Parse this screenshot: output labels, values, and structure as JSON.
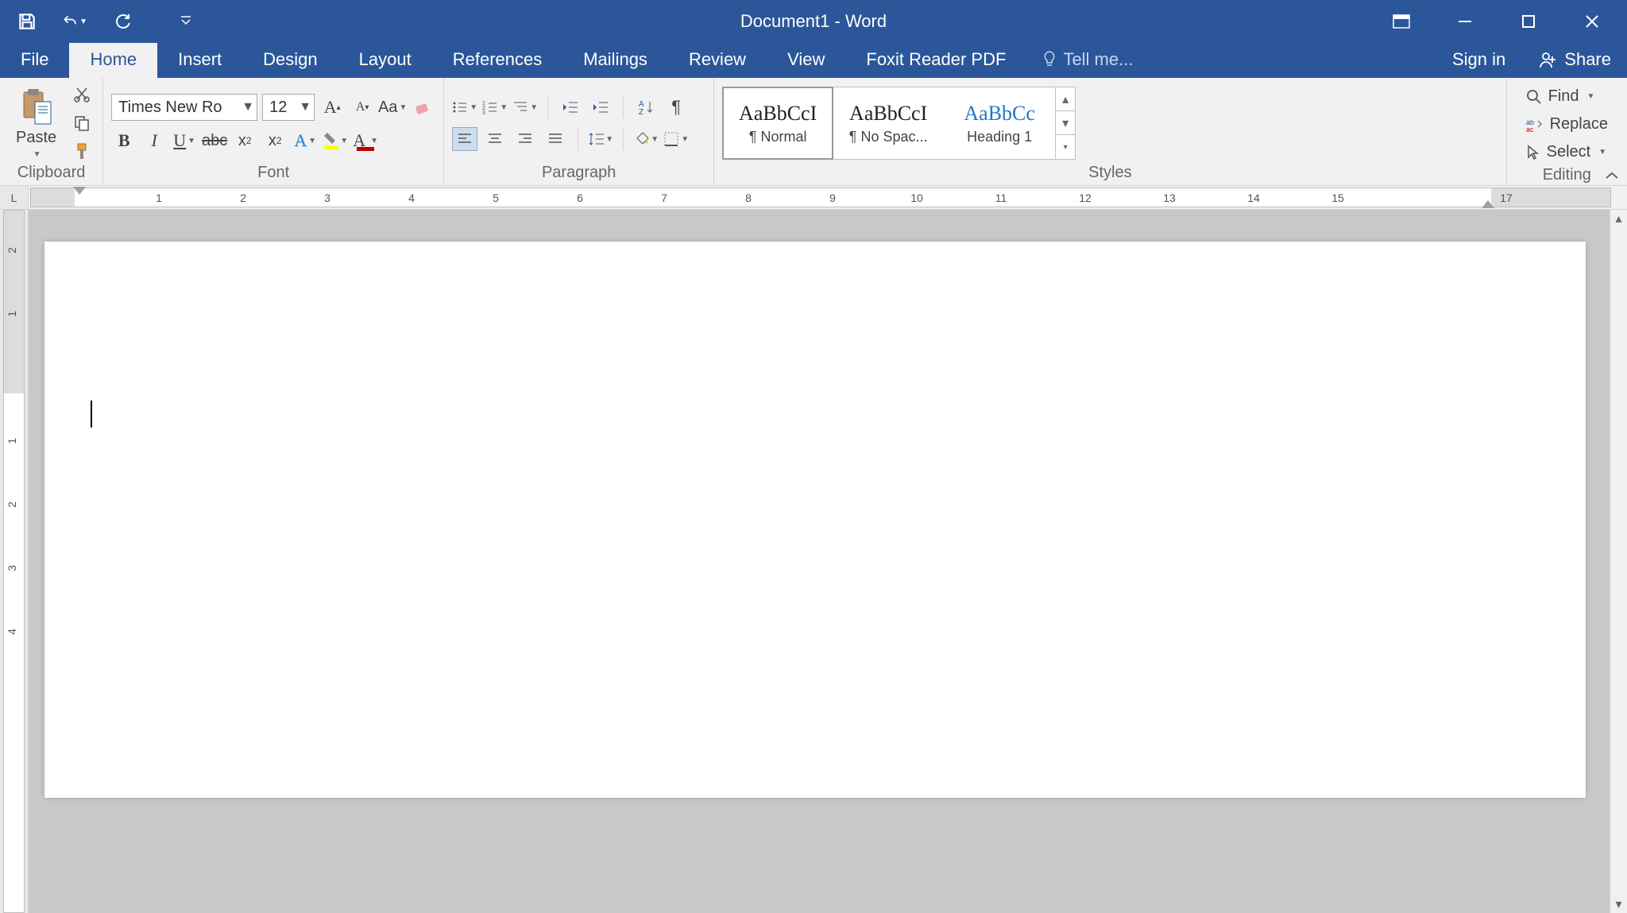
{
  "title": "Document1 - Word",
  "tabs": {
    "file": "File",
    "items": [
      "Home",
      "Insert",
      "Design",
      "Layout",
      "References",
      "Mailings",
      "Review",
      "View",
      "Foxit Reader PDF"
    ],
    "active": "Home",
    "tellme": "Tell me...",
    "signin": "Sign in",
    "share": "Share"
  },
  "ribbon": {
    "clipboard": {
      "label": "Clipboard",
      "paste": "Paste"
    },
    "font": {
      "label": "Font",
      "name": "Times New Ro",
      "size": "12"
    },
    "paragraph": {
      "label": "Paragraph"
    },
    "styles": {
      "label": "Styles",
      "items": [
        {
          "preview": "AaBbCcI",
          "name": "¶ Normal",
          "selected": true
        },
        {
          "preview": "AaBbCcI",
          "name": "¶ No Spac...",
          "selected": false
        },
        {
          "preview": "AaBbCc",
          "name": "Heading 1",
          "selected": false,
          "heading": true
        }
      ]
    },
    "editing": {
      "label": "Editing",
      "find": "Find",
      "replace": "Replace",
      "select": "Select"
    }
  },
  "ruler": {
    "h_marks": [
      1,
      2,
      3,
      4,
      5,
      6,
      7,
      8,
      9,
      10,
      11,
      12,
      13,
      14,
      15,
      17
    ],
    "v_marks": [
      2,
      1,
      1,
      2,
      3,
      4
    ],
    "corner": "L"
  }
}
